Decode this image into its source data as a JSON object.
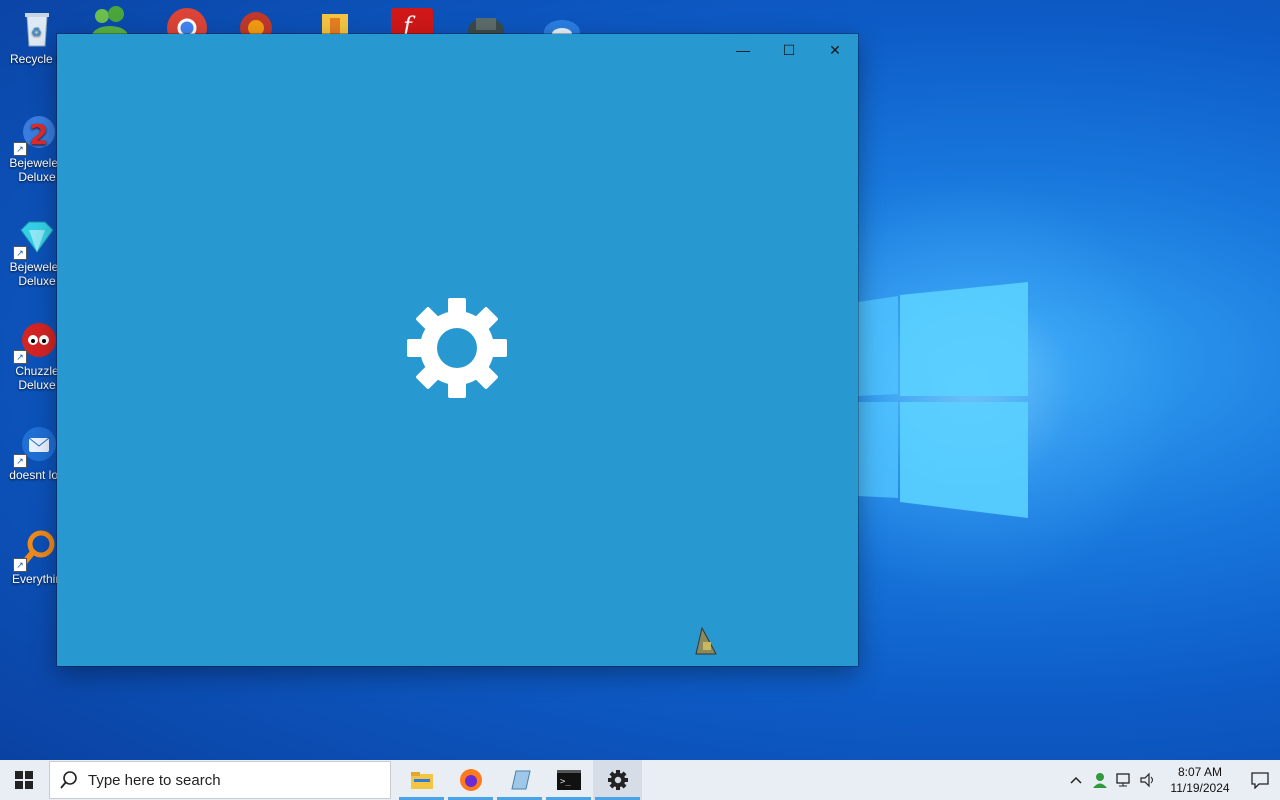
{
  "desktop": {
    "icons": [
      {
        "label": "Recycle B",
        "icon": "recycle-bin-icon"
      },
      {
        "label": "Bejeweled Deluxe",
        "line1": "Bejeweled",
        "line2": "Deluxe",
        "icon": "bejeweled2-icon"
      },
      {
        "label": "Bejeweled Deluxe",
        "line1": "Bejewelec",
        "line2": "Deluxe",
        "icon": "bejeweled-icon"
      },
      {
        "label": "Chuzzle Deluxe",
        "line1": "Chuzzle",
        "line2": "Deluxe",
        "icon": "chuzzle-icon"
      },
      {
        "label": "doesnt loa",
        "icon": "thunderbird-icon"
      },
      {
        "label": "Everythin",
        "icon": "everything-search-icon"
      }
    ],
    "top_row_icons": [
      "users-icon",
      "chrome-icon",
      "app-icon",
      "archive-icon",
      "flash-icon",
      "castle-icon",
      "bird-icon"
    ]
  },
  "window": {
    "controls": {
      "minimize": "—",
      "maximize": "☐",
      "close": "✕"
    },
    "splash_icon": "settings-gear-icon",
    "bg_color": "#2899d0"
  },
  "taskbar": {
    "search_placeholder": "Type here to search",
    "apps": [
      "file-explorer-icon",
      "firefox-icon",
      "notepad-icon",
      "terminal-icon",
      "settings-icon"
    ],
    "clock": {
      "time": "8:07 AM",
      "date": "11/19/2024"
    },
    "tray": [
      "chevron-up-icon",
      "user-icon",
      "network-icon",
      "volume-icon"
    ]
  }
}
